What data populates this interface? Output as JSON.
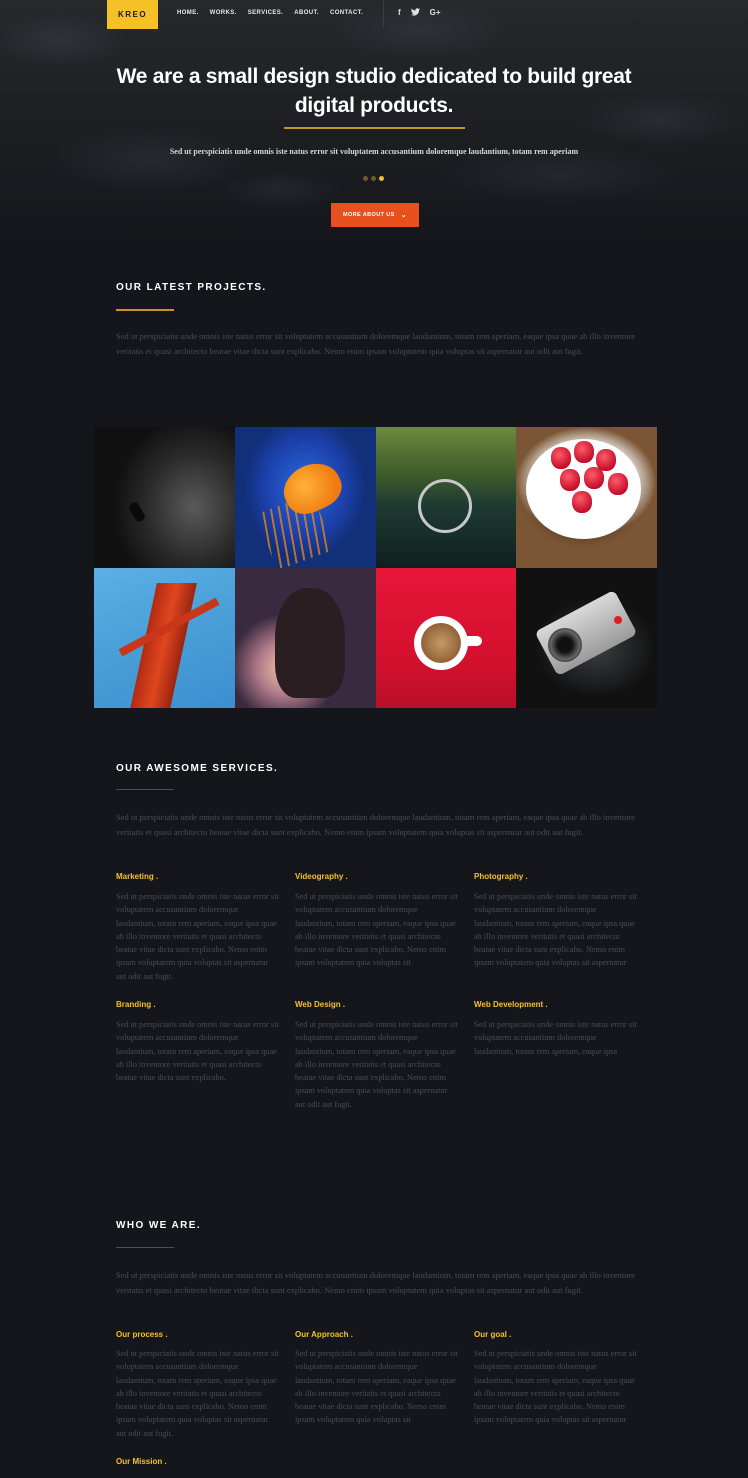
{
  "brand": {
    "logo": "KREO"
  },
  "nav": [
    "HOME.",
    "WORKS.",
    "SERVICES.",
    "ABOUT.",
    "CONTACT."
  ],
  "social": [
    {
      "icon": "facebook-icon",
      "glyph": "f"
    },
    {
      "icon": "twitter-icon",
      "glyph": "🐦"
    },
    {
      "icon": "google-plus-icon",
      "glyph": "G+"
    }
  ],
  "hero": {
    "title_line1": "We are a small design studio dedicated to build great",
    "title_line2": "digital products.",
    "subtitle": "Sed ut perspiciatis unde omnis iste natus error sit voluptatem accusantium doloremque laudantium, totam rem aperiam",
    "slides": 3,
    "active_slide": 3,
    "cta_label": "MORE ABOUT US"
  },
  "projects": {
    "title": "OUR LATEST PROJECTS.",
    "text": "Sed ut perspiciatis unde omnis iste natus error sit voluptatem accusantium doloremque laudantium, totam rem aperiam, eaque ipsa quae ab illo inventore veritatis et quasi architecto beatae vitae dicta sunt explicabo. Nemo enim ipsam voluptatem quia voluptas sit aspernatur aut odit aut fugit.",
    "images": [
      "diver-image",
      "jellyfish-image",
      "vintage-car-image",
      "raspberries-image",
      "bridge-image",
      "woman-image",
      "coffee-image",
      "camera-image"
    ]
  },
  "services": {
    "title": "OUR AWESOME SERVICES.",
    "text": "Sed ut perspiciatis unde omnis iste natus error sit voluptatem accusantium doloremque laudantium, totam rem aperiam, eaque ipsa quae ab illo inventore veritatis et quasi architecto beatae vitae dicta sunt explicabo. Nemo enim ipsam voluptatem quia voluptas sit aspernatur aut odit aut fugit.",
    "items": [
      {
        "title": "Marketing .",
        "text": "Sed ut perspiciatis unde omnis iste natus error sit voluptatem accusantium doloremque laudantium, totam rem aperiam, eaque ipsa quae ab illo inventore veritatis et quasi architecto beatae vitae dicta sunt explicabo. Nemo enim ipsam voluptatem quia voluptas sit aspernatur aut odit aut fugit."
      },
      {
        "title": "Videography .",
        "text": "Sed ut perspiciatis unde omnis iste natus error sit voluptatem accusantium doloremque laudantium, totam rem aperiam, eaque ipsa quae ab illo inventore veritatis et quasi architecto beatae vitae dicta sunt explicabo. Nemo enim ipsam voluptatem quia voluptas sit"
      },
      {
        "title": "Photography .",
        "text": "Sed ut perspiciatis unde omnis iste natus error sit voluptatem accusantium doloremque laudantium, totam rem aperiam, eaque ipsa quae ab illo inventore veritatis et quasi architecto beatae vitae dicta sunt explicabo. Nemo enim ipsam voluptatem quia voluptas sit aspernatur"
      },
      {
        "title": "Branding .",
        "text": "Sed ut perspiciatis unde omnis iste natus error sit voluptatem accusantium doloremque laudantium, totam rem aperiam, eaque ipsa quae ab illo inventore veritatis et quasi architecto beatae vitae dicta sunt explicabo."
      },
      {
        "title": "Web Design .",
        "text": "Sed ut perspiciatis unde omnis iste natus error sit voluptatem accusantium doloremque laudantium, totam rem aperiam, eaque ipsa quae ab illo inventore veritatis et quasi architecto beatae vitae dicta sunt explicabo. Nemo enim ipsam voluptatem quia voluptas sit aspernatur aut odit aut fugit."
      },
      {
        "title": "Web Development .",
        "text": "Sed ut perspiciatis unde omnis iste natus error sit voluptatem accusantium doloremque laudantium, totam rem aperiam, eaque ipsa"
      }
    ]
  },
  "about": {
    "title": "WHO WE ARE.",
    "text": "Sed ut perspiciatis unde omnis iste natus error sit voluptatem accusantium doloremque laudantium, totam rem aperiam, eaque ipsa quae ab illo inventore veritatis et quasi architecto beatae vitae dicta sunt explicabo. Nemo enim ipsam voluptatem quia voluptas sit aspernatur aut odit aut fugit.",
    "items": [
      {
        "title": "Our process .",
        "text": "Sed ut perspiciatis unde omnis iste natus error sit voluptatem accusantium doloremque laudantium, totam rem aperiam, eaque ipsa quae ab illo inventore veritatis et quasi architecto beatae vitae dicta sunt explicabo. Nemo enim ipsam voluptatem quia voluptas sit aspernatur aut odit aut fugit."
      },
      {
        "title": "Our Approach .",
        "text": "Sed ut perspiciatis unde omnis iste natus error sit voluptatem accusantium doloremque laudantium, totam rem aperiam, eaque ipsa quae ab illo inventore veritatis et quasi architecto beatae vitae dicta sunt explicabo. Nemo enim ipsam voluptatem quia voluptas sit"
      },
      {
        "title": "Our goal .",
        "text": "Sed ut perspiciatis unde omnis iste natus error sit voluptatem accusantium doloremque laudantium, totam rem aperiam, eaque ipsa quae ab illo inventore veritatis et quasi architecto beatae vitae dicta sunt explicabo. Nemo enim ipsam voluptatem quia voluptas sit aspernatur"
      },
      {
        "title": "Our Mission .",
        "text": ""
      }
    ]
  },
  "colors": {
    "accent": "#f5c127",
    "cta": "#e8501d",
    "rule": "#c6952a",
    "background": "#14161b"
  }
}
